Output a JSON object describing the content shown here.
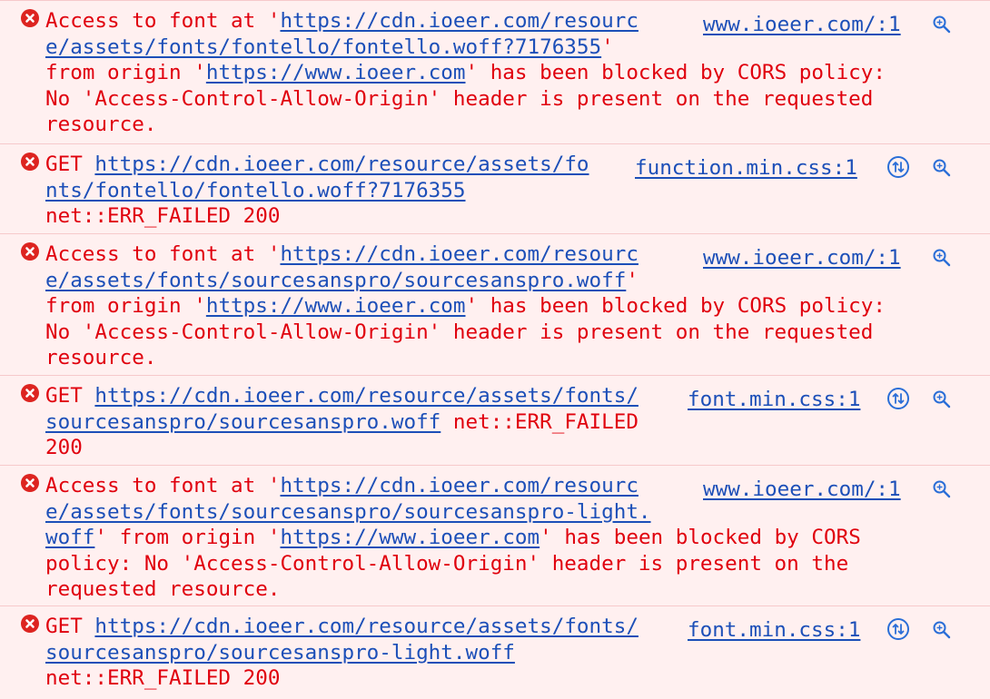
{
  "colors": {
    "background": "#fff0f0",
    "error_text": "#e0000d",
    "link": "#1c4fb8",
    "error_icon": "#dd2420",
    "separator": "#f6c9cb"
  },
  "icons": {
    "error": "error-circle-x-icon",
    "network": "network-request-icon",
    "search": "magnifier-search-icon"
  },
  "messages": [
    {
      "source": "www.ioeer.com/:1",
      "lines": [
        [
          {
            "t": "Access to font at '"
          },
          {
            "t": "https://cdn.ioeer.com/resourc",
            "link": true
          }
        ],
        [
          {
            "t": "e/assets/fonts/fontello/fontello.woff?7176355",
            "link": true
          },
          {
            "t": "'"
          }
        ],
        [
          {
            "t": "from origin '"
          },
          {
            "t": "https://www.ioeer.com",
            "link": true
          },
          {
            "t": "' has been blocked by CORS policy:"
          }
        ],
        [
          {
            "t": "No 'Access-Control-Allow-Origin' header is present on the requested"
          }
        ],
        [
          {
            "t": "resource."
          }
        ]
      ]
    },
    {
      "source": "function.min.css:1",
      "lines": [
        [
          {
            "t": "GET "
          },
          {
            "t": "https://cdn.ioeer.com/resource/assets/fo",
            "link": true
          }
        ],
        [
          {
            "t": "nts/fontello/fontello.woff?7176355",
            "link": true
          }
        ],
        [
          {
            "t": "net::ERR_FAILED 200"
          }
        ]
      ]
    },
    {
      "source": "www.ioeer.com/:1",
      "lines": [
        [
          {
            "t": "Access to font at '"
          },
          {
            "t": "https://cdn.ioeer.com/resourc",
            "link": true
          }
        ],
        [
          {
            "t": "e/assets/fonts/sourcesanspro/sourcesanspro.woff",
            "link": true
          },
          {
            "t": "'"
          }
        ],
        [
          {
            "t": "from origin '"
          },
          {
            "t": "https://www.ioeer.com",
            "link": true
          },
          {
            "t": "' has been blocked by CORS policy:"
          }
        ],
        [
          {
            "t": "No 'Access-Control-Allow-Origin' header is present on the requested"
          }
        ],
        [
          {
            "t": "resource."
          }
        ]
      ]
    },
    {
      "source": "font.min.css:1",
      "lines": [
        [
          {
            "t": "GET "
          },
          {
            "t": "https://cdn.ioeer.com/resource/assets/fonts/",
            "link": true
          }
        ],
        [
          {
            "t": "sourcesanspro/sourcesanspro.woff",
            "link": true
          },
          {
            "t": " net::ERR_FAILED"
          }
        ],
        [
          {
            "t": "200"
          }
        ]
      ]
    },
    {
      "source": "www.ioeer.com/:1",
      "lines": [
        [
          {
            "t": "Access to font at '"
          },
          {
            "t": "https://cdn.ioeer.com/resourc",
            "link": true
          }
        ],
        [
          {
            "t": "e/assets/fonts/sourcesanspro/sourcesanspro-light.",
            "link": true
          }
        ],
        [
          {
            "t": "woff",
            "link": true
          },
          {
            "t": "' from origin '"
          },
          {
            "t": "https://www.ioeer.com",
            "link": true
          },
          {
            "t": "' has been blocked by CORS"
          }
        ],
        [
          {
            "t": "policy: No 'Access-Control-Allow-Origin' header is present on the"
          }
        ],
        [
          {
            "t": "requested resource."
          }
        ]
      ]
    },
    {
      "source": "font.min.css:1",
      "lines": [
        [
          {
            "t": "GET "
          },
          {
            "t": "https://cdn.ioeer.com/resource/assets/fonts/",
            "link": true
          }
        ],
        [
          {
            "t": "sourcesanspro/sourcesanspro-light.woff",
            "link": true
          }
        ],
        [
          {
            "t": "net::ERR_FAILED 200"
          }
        ]
      ]
    }
  ]
}
